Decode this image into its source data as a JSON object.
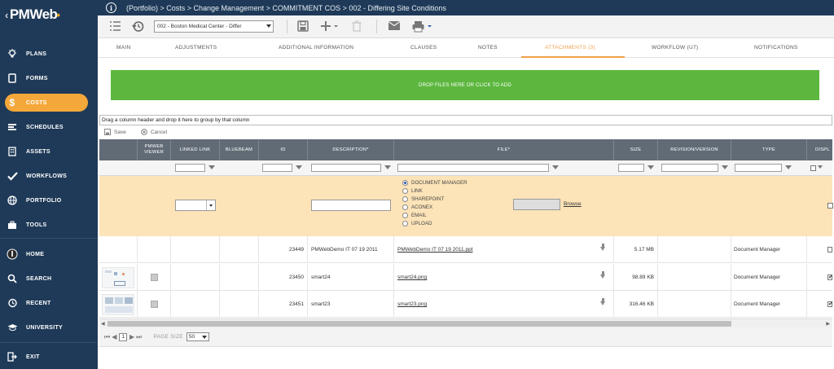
{
  "app": {
    "logo": "PMWeb"
  },
  "breadcrumb": "(Portfolio) > Costs > Change Management > COMMITMENT COS > 002 - Differing Site Conditions",
  "sidebar": {
    "items": [
      {
        "label": "PLANS",
        "icon": "lightbulb-icon"
      },
      {
        "label": "FORMS",
        "icon": "document-icon"
      },
      {
        "label": "COSTS",
        "icon": "dollar-icon",
        "active": true
      },
      {
        "label": "SCHEDULES",
        "icon": "schedule-icon"
      },
      {
        "label": "ASSETS",
        "icon": "building-icon"
      },
      {
        "label": "WORKFLOWS",
        "icon": "check-icon"
      },
      {
        "label": "PORTFOLIO",
        "icon": "globe-icon"
      },
      {
        "label": "TOOLS",
        "icon": "toolbox-icon"
      },
      {
        "label": "HOME",
        "icon": "avatar-icon"
      },
      {
        "label": "SEARCH",
        "icon": "search-icon"
      },
      {
        "label": "RECENT",
        "icon": "history-icon"
      },
      {
        "label": "UNIVERSITY",
        "icon": "graduation-icon"
      },
      {
        "label": "EXIT",
        "icon": "exit-icon"
      }
    ]
  },
  "toolbar": {
    "project_value": "002 - Boston Medical Center - Differ"
  },
  "tabs": [
    {
      "label": "MAIN"
    },
    {
      "label": "ADJUSTMENTS"
    },
    {
      "label": "ADDITIONAL INFORMATION"
    },
    {
      "label": "CLAUSES"
    },
    {
      "label": "NOTES"
    },
    {
      "label": "ATTACHMENTS (3)",
      "active": true
    },
    {
      "label": "WORKFLOW (U7)"
    },
    {
      "label": "NOTIFICATIONS"
    }
  ],
  "dropzone": {
    "text": "DROP FILES HERE OR CLICK TO ADD"
  },
  "grid": {
    "group_text": "Drag a column header and drop it here to group by that column",
    "save_label": "Save",
    "cancel_label": "Cancel",
    "columns": {
      "viewer": "PMWEB VIEWER",
      "linked": "LINKED LINK",
      "bluebeam": "BLUEBEAM",
      "id": "ID",
      "description": "DESCRIPTION*",
      "file": "FILE*",
      "size": "SIZE",
      "revision": "REVISION/VERSION",
      "type": "TYPE",
      "display": "DISPL"
    },
    "source_options": [
      "DOCUMENT MANAGER",
      "LINK",
      "SHAREPOINT",
      "ACONEX",
      "EMAIL",
      "UPLOAD"
    ],
    "browse_label": "Browse",
    "rows": [
      {
        "id": "23449",
        "description": "PMWebDemo IT 07 19 2011",
        "file": "PMWebDemo IT 07 19 2011.ppt",
        "size": "5.17 MB",
        "type": "Document Manager",
        "display": false
      },
      {
        "id": "23450",
        "description": "smart24",
        "file": "smart24.png",
        "size": "98.89 KB",
        "type": "Document Manager",
        "display": true
      },
      {
        "id": "23451",
        "description": "smart23",
        "file": "smart23.png",
        "size": "316.46 KB",
        "type": "Document Manager",
        "display": true
      }
    ]
  },
  "pager": {
    "current_page": "1",
    "page_size_label": "PAGE SIZE",
    "page_size": "50"
  }
}
